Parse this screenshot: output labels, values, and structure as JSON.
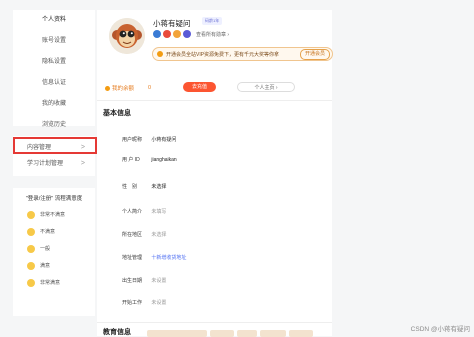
{
  "sidebar": {
    "menu": [
      {
        "label": "个人资料",
        "active": true
      },
      {
        "label": "账号设置"
      },
      {
        "label": "隐私设置"
      },
      {
        "label": "信息认证"
      },
      {
        "label": "我的收藏"
      },
      {
        "label": "浏览历史"
      }
    ],
    "menu2": [
      {
        "label": "内容管理",
        "chevron": ">"
      },
      {
        "label": "学习计划管理",
        "chevron": ">"
      }
    ],
    "survey": {
      "title": "\"登录/注册\" 流程满意度",
      "options": [
        "非常不满意",
        "不满意",
        "一般",
        "满意",
        "非常满意"
      ]
    }
  },
  "profile": {
    "name": "小蒋有疑问",
    "level_badge": "码龄1年",
    "badges_more": "查看所有勋章 ›",
    "vip_text": "开通会员全站VIP资源免费下，更有千元大奖等你拿",
    "vip_button": "开通会员",
    "balance_label": "我的余额",
    "balance_value": "0",
    "recharge": "去充值",
    "homepage": "个人主页 ›"
  },
  "basic_info": {
    "title": "基本信息",
    "rows": [
      {
        "label": "用户昵称",
        "value": "小蒋有疑问",
        "style": "normal"
      },
      {
        "label": "用 户 ID",
        "value": "jianghaikan",
        "style": "normal"
      },
      {
        "label": "性　别",
        "value": "未选择",
        "style": "normal"
      },
      {
        "label": "个人简介",
        "value": "未填写",
        "style": "muted"
      },
      {
        "label": "所在地区",
        "value": "未选择",
        "style": "muted"
      },
      {
        "label": "地址管理",
        "value": "十新增收货地址",
        "style": "link"
      },
      {
        "label": "出生日期",
        "value": "未设置",
        "style": "muted"
      },
      {
        "label": "开始工作",
        "value": "未设置",
        "style": "muted"
      }
    ]
  },
  "edu_title": "教育信息",
  "watermark": "CSDN @小蒋有疑问",
  "colors": {
    "accent": "#fc5531",
    "highlight": "#e53935",
    "link": "#4e6ef2",
    "vip": "#f0c58f"
  }
}
